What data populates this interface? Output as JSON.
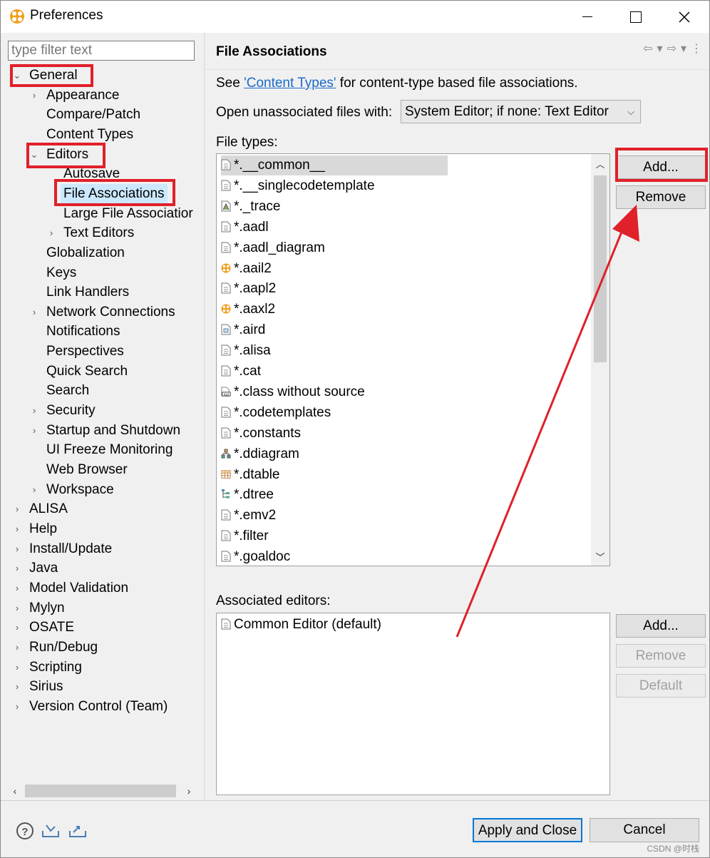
{
  "window": {
    "title": "Preferences",
    "icon": "eclipse-gear-icon"
  },
  "left": {
    "filter_placeholder": "type filter text",
    "tree": [
      {
        "label": "General",
        "chevron": "⌄",
        "level": 0,
        "highlighted": true
      },
      {
        "label": "Appearance",
        "chevron": "›",
        "level": 1
      },
      {
        "label": "Compare/Patch",
        "chevron": "",
        "level": 1
      },
      {
        "label": "Content Types",
        "chevron": "",
        "level": 1
      },
      {
        "label": "Editors",
        "chevron": "⌄",
        "level": 1,
        "highlighted": true
      },
      {
        "label": "Autosave",
        "chevron": "",
        "level": 2
      },
      {
        "label": "File Associations",
        "chevron": "",
        "level": 2,
        "selected": true,
        "highlighted": true
      },
      {
        "label": "Large File Associatior",
        "chevron": "",
        "level": 2
      },
      {
        "label": "Text Editors",
        "chevron": "›",
        "level": 2
      },
      {
        "label": "Globalization",
        "chevron": "",
        "level": 1
      },
      {
        "label": "Keys",
        "chevron": "",
        "level": 1
      },
      {
        "label": "Link Handlers",
        "chevron": "",
        "level": 1
      },
      {
        "label": "Network Connections",
        "chevron": "›",
        "level": 1
      },
      {
        "label": "Notifications",
        "chevron": "",
        "level": 1
      },
      {
        "label": "Perspectives",
        "chevron": "",
        "level": 1
      },
      {
        "label": "Quick Search",
        "chevron": "",
        "level": 1
      },
      {
        "label": "Search",
        "chevron": "",
        "level": 1
      },
      {
        "label": "Security",
        "chevron": "›",
        "level": 1
      },
      {
        "label": "Startup and Shutdown",
        "chevron": "›",
        "level": 1
      },
      {
        "label": "UI Freeze Monitoring",
        "chevron": "",
        "level": 1
      },
      {
        "label": "Web Browser",
        "chevron": "",
        "level": 1
      },
      {
        "label": "Workspace",
        "chevron": "›",
        "level": 1
      },
      {
        "label": "ALISA",
        "chevron": "›",
        "level": 0
      },
      {
        "label": "Help",
        "chevron": "›",
        "level": 0
      },
      {
        "label": "Install/Update",
        "chevron": "›",
        "level": 0
      },
      {
        "label": "Java",
        "chevron": "›",
        "level": 0
      },
      {
        "label": "Model Validation",
        "chevron": "›",
        "level": 0
      },
      {
        "label": "Mylyn",
        "chevron": "›",
        "level": 0
      },
      {
        "label": "OSATE",
        "chevron": "›",
        "level": 0
      },
      {
        "label": "Run/Debug",
        "chevron": "›",
        "level": 0
      },
      {
        "label": "Scripting",
        "chevron": "›",
        "level": 0
      },
      {
        "label": "Sirius",
        "chevron": "›",
        "level": 0
      },
      {
        "label": "Version Control (Team)",
        "chevron": "›",
        "level": 0
      }
    ]
  },
  "page": {
    "title": "File Associations",
    "see_prefix": "See ",
    "content_types_link": "'Content Types'",
    "see_suffix": " for content-type based file associations.",
    "open_unassoc_label": "Open unassociated files with:",
    "open_unassoc_value": "System Editor; if none: Text Editor",
    "file_types_label": "File types:",
    "file_types": [
      {
        "name": "*.__common__",
        "icon": "text-file-icon",
        "selected": true
      },
      {
        "name": "*.__singlecodetemplate",
        "icon": "text-file-icon"
      },
      {
        "name": "*._trace",
        "icon": "trace-file-icon"
      },
      {
        "name": "*.aadl",
        "icon": "text-file-icon"
      },
      {
        "name": "*.aadl_diagram",
        "icon": "text-file-icon"
      },
      {
        "name": "*.aail2",
        "icon": "osate-icon"
      },
      {
        "name": "*.aapl2",
        "icon": "text-file-icon"
      },
      {
        "name": "*.aaxl2",
        "icon": "osate-icon"
      },
      {
        "name": "*.aird",
        "icon": "aird-file-icon"
      },
      {
        "name": "*.alisa",
        "icon": "text-file-icon"
      },
      {
        "name": "*.cat",
        "icon": "text-file-icon"
      },
      {
        "name": "*.class without source",
        "icon": "class-file-icon"
      },
      {
        "name": "*.codetemplates",
        "icon": "text-file-icon"
      },
      {
        "name": "*.constants",
        "icon": "text-file-icon"
      },
      {
        "name": "*.ddiagram",
        "icon": "diagram-icon"
      },
      {
        "name": "*.dtable",
        "icon": "table-icon"
      },
      {
        "name": "*.dtree",
        "icon": "tree-icon"
      },
      {
        "name": "*.emv2",
        "icon": "text-file-icon"
      },
      {
        "name": "*.filter",
        "icon": "text-file-icon"
      },
      {
        "name": "*.goaldoc",
        "icon": "text-file-icon"
      }
    ],
    "add_label": "Add...",
    "remove_label": "Remove",
    "assoc_label": "Associated editors:",
    "assoc_editors": [
      {
        "name": "Common Editor (default)",
        "icon": "text-file-icon"
      }
    ],
    "assoc_add_label": "Add...",
    "assoc_remove_label": "Remove",
    "assoc_default_label": "Default"
  },
  "bottom": {
    "apply_close_label": "Apply and Close",
    "cancel_label": "Cancel",
    "watermark": "CSDN @时栈"
  },
  "colors": {
    "annotation_red": "#e0202a",
    "link_blue": "#1b6ac9",
    "selection_blue": "#cce8ff",
    "focus_blue": "#0078d7"
  }
}
